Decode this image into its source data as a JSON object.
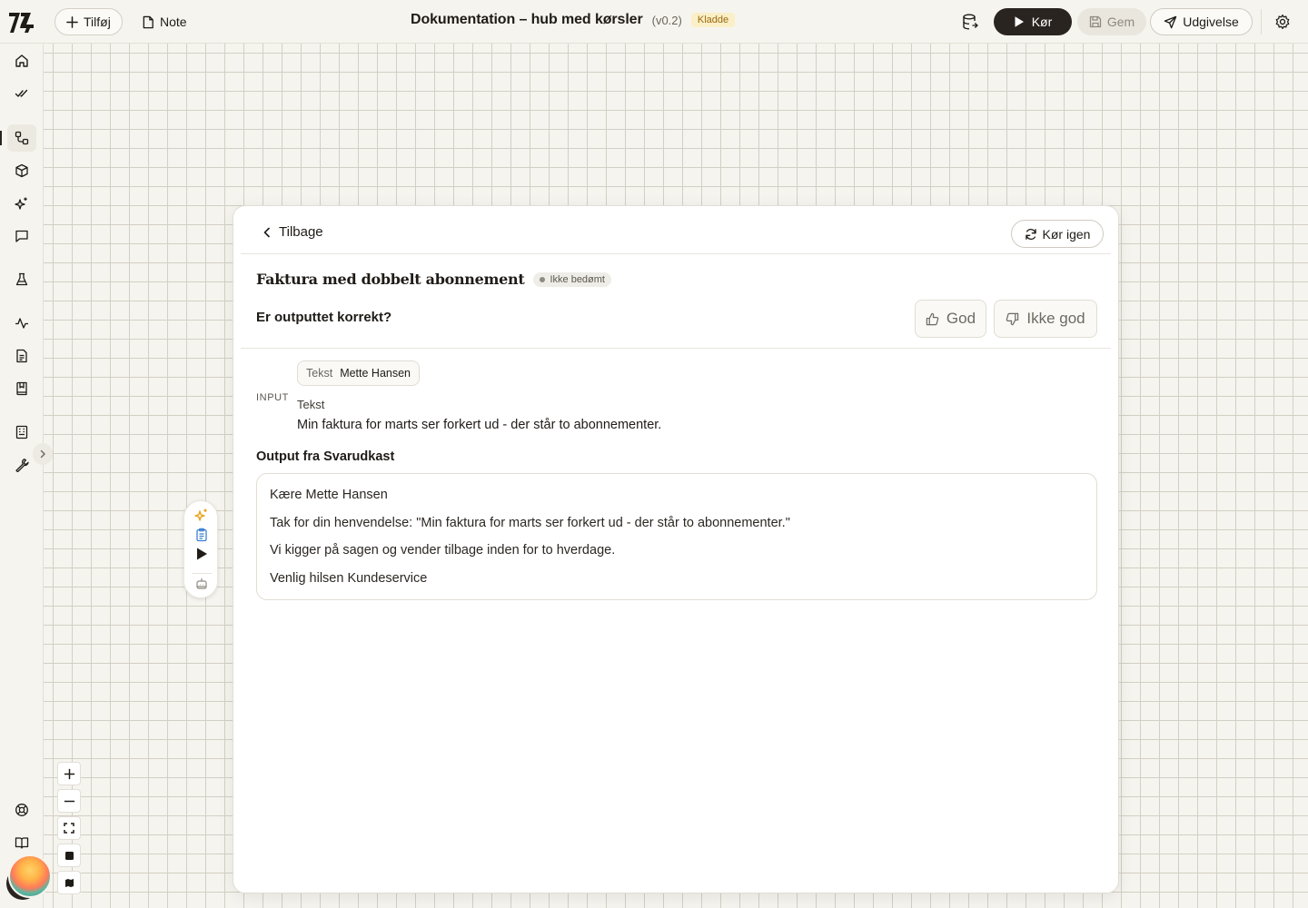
{
  "topbar": {
    "add_label": "Tilføj",
    "note_label": "Note",
    "title": "Dokumentation – hub med kørsler",
    "version": "(v0.2)",
    "status_badge": "Kladde",
    "run_label": "Kør",
    "save_label": "Gem",
    "publish_label": "Udgivelse"
  },
  "panel": {
    "back_label": "Tilbage",
    "rerun_label": "Kør igen",
    "case_title": "Faktura med dobbelt abonnement",
    "rating_status": "Ikke bedømt",
    "question": "Er outputtet korrekt?",
    "good_label": "God",
    "bad_label": "Ikke god",
    "input_section_label": "INPUT",
    "input_chip_key": "Tekst",
    "input_chip_value": "Mette Hansen",
    "input_field_name": "Tekst",
    "input_field_value": "Min faktura for marts ser forkert ud - der står to abonnementer.",
    "output_heading": "Output fra Svarudkast",
    "output_lines": [
      "Kære Mette Hansen",
      "Tak for din henvendelse: \"Min faktura for marts ser forkert ud - der står to abonnementer.\"",
      "Vi kigger på sagen og vender tilbage inden for to hverdage.",
      "Venlig hilsen Kundeservice"
    ]
  },
  "sidebar": {
    "items": [
      "home-icon",
      "check-check-icon",
      "workflow-icon",
      "box-icon",
      "sparkles-icon",
      "message-icon",
      "flask-icon",
      "activity-icon",
      "file-text-icon",
      "book-icon",
      "building-icon",
      "wrench-icon"
    ],
    "bottom_items": [
      "help-icon",
      "open-book-icon"
    ],
    "active_index": 2
  },
  "colors": {
    "accent_dark": "#2a2420",
    "draft_badge_bg": "#fbefc7",
    "canvas_bg": "#f6f4ee"
  }
}
